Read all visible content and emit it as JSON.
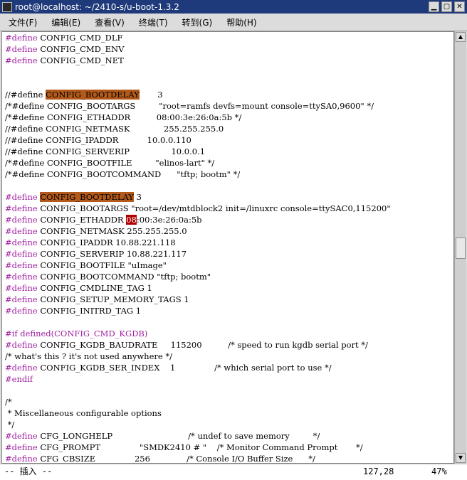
{
  "window": {
    "title": "root@localhost: ~/2410-s/u-boot-1.3.2",
    "min_icon": "minimize-icon",
    "max_icon": "maximize-icon",
    "close_icon": "close-icon"
  },
  "menu": [
    "文件(F)",
    "编辑(E)",
    "查看(V)",
    "终端(T)",
    "转到(G)",
    "帮助(H)"
  ],
  "colors": {
    "preproc": "#a020a0",
    "highlight_search": "#b35a1a",
    "cursor": "#b00000",
    "titlebar": "#1f3a7a"
  },
  "lines": [
    [
      {
        "t": "#define",
        "c": "pp"
      },
      {
        "t": " CONFIG_CMD_DLF",
        "c": "id"
      }
    ],
    [
      {
        "t": "#define",
        "c": "pp"
      },
      {
        "t": " CONFIG_CMD_ENV",
        "c": "id"
      }
    ],
    [
      {
        "t": "#define",
        "c": "pp"
      },
      {
        "t": " CONFIG_CMD_NET",
        "c": "id"
      }
    ],
    [],
    [],
    [
      {
        "t": "//#define ",
        "c": "cm"
      },
      {
        "t": "CONFIG_BOOTDELAY",
        "c": "hl-brown"
      },
      {
        "t": "       3",
        "c": "cm"
      }
    ],
    [
      {
        "t": "/*#define CONFIG_BOOTARGS         \"root=ramfs devfs=mount console=ttySA0,9600\" */",
        "c": "cm"
      }
    ],
    [
      {
        "t": "/*#define CONFIG_ETHADDR          08:00:3e:26:0a:5b */",
        "c": "cm"
      }
    ],
    [
      {
        "t": "//#define CONFIG_NETMASK             255.255.255.0",
        "c": "cm"
      }
    ],
    [
      {
        "t": "//#define CONFIG_IPADDR           10.0.0.110",
        "c": "cm"
      }
    ],
    [
      {
        "t": "//#define CONFIG_SERVERIP                10.0.0.1",
        "c": "cm"
      }
    ],
    [
      {
        "t": "/*#define CONFIG_BOOTFILE         \"elinos-lart\" */",
        "c": "cm"
      }
    ],
    [
      {
        "t": "/*#define CONFIG_BOOTCOMMAND      \"tftp; bootm\" */",
        "c": "cm"
      }
    ],
    [],
    [
      {
        "t": "#define",
        "c": "pp"
      },
      {
        "t": " ",
        "c": "id"
      },
      {
        "t": "CONFIG_BOOTDELAY",
        "c": "hl-brown"
      },
      {
        "t": " 3",
        "c": "id"
      }
    ],
    [
      {
        "t": "#define",
        "c": "pp"
      },
      {
        "t": " CONFIG_BOOTARGS \"root=/dev/mtdblock2 init=/linuxrc console=ttySAC0,115200\"",
        "c": "id"
      }
    ],
    [
      {
        "t": "#define",
        "c": "pp"
      },
      {
        "t": " CONFIG_ETHADDR ",
        "c": "id"
      },
      {
        "t": "08",
        "c": "hl-red"
      },
      {
        "t": ":00:3e:26:0a:5b",
        "c": "id"
      }
    ],
    [
      {
        "t": "#define",
        "c": "pp"
      },
      {
        "t": " CONFIG_NETMASK 255.255.255.0",
        "c": "id"
      }
    ],
    [
      {
        "t": "#define",
        "c": "pp"
      },
      {
        "t": " CONFIG_IPADDR 10.88.221.118",
        "c": "id"
      }
    ],
    [
      {
        "t": "#define",
        "c": "pp"
      },
      {
        "t": " CONFIG_SERVERIP 10.88.221.117",
        "c": "id"
      }
    ],
    [
      {
        "t": "#define",
        "c": "pp"
      },
      {
        "t": " CONFIG_BOOTFILE \"uImage\"",
        "c": "id"
      }
    ],
    [
      {
        "t": "#define",
        "c": "pp"
      },
      {
        "t": " CONFIG_BOOTCOMMAND \"tftp; bootm\"",
        "c": "id"
      }
    ],
    [
      {
        "t": "#define",
        "c": "pp"
      },
      {
        "t": " CONFIG_CMDLINE_TAG 1",
        "c": "id"
      }
    ],
    [
      {
        "t": "#define",
        "c": "pp"
      },
      {
        "t": " CONFIG_SETUP_MEMORY_TAGS 1",
        "c": "id"
      }
    ],
    [
      {
        "t": "#define",
        "c": "pp"
      },
      {
        "t": " CONFIG_INITRD_TAG 1",
        "c": "id"
      }
    ],
    [],
    [
      {
        "t": "#if defined(CONFIG_CMD_KGDB)",
        "c": "pp"
      }
    ],
    [
      {
        "t": "#define",
        "c": "pp"
      },
      {
        "t": " CONFIG_KGDB_BAUDRATE     115200          /* speed to run kgdb serial port */",
        "c": "id"
      }
    ],
    [
      {
        "t": "/* what's this ? it's not used anywhere */",
        "c": "cm"
      }
    ],
    [
      {
        "t": "#define",
        "c": "pp"
      },
      {
        "t": " CONFIG_KGDB_SER_INDEX    1               /* which serial port to use */",
        "c": "id"
      }
    ],
    [
      {
        "t": "#endif",
        "c": "pp"
      }
    ],
    [],
    [
      {
        "t": "/*",
        "c": "cm"
      }
    ],
    [
      {
        "t": " * Miscellaneous configurable options",
        "c": "cm"
      }
    ],
    [
      {
        "t": " */",
        "c": "cm"
      }
    ],
    [
      {
        "t": "#define",
        "c": "pp"
      },
      {
        "t": " CFG_LONGHELP                             /* undef to save memory         */",
        "c": "id"
      }
    ],
    [
      {
        "t": "#define",
        "c": "pp"
      },
      {
        "t": " CFG_PROMPT               \"SMDK2410 # \"    /* Monitor Command Prompt       */",
        "c": "id"
      }
    ],
    [
      {
        "t": "#define",
        "c": "pp"
      },
      {
        "t": " CFG_CBSIZE               256              /* Console I/O Buffer Size      */",
        "c": "id"
      }
    ]
  ],
  "status": {
    "mode": "-- 插入 --",
    "position": "127,28",
    "percent": "47%"
  }
}
